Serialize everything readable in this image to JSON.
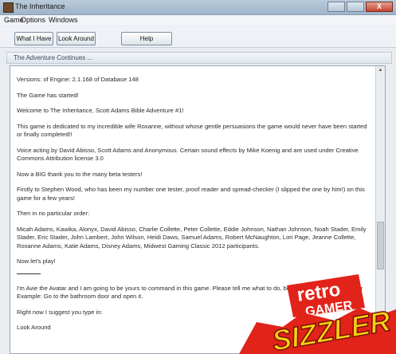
{
  "window": {
    "title": "The Inheritance",
    "close_label": "X"
  },
  "menu": [
    "Game",
    "Options",
    "Windows"
  ],
  "toolbar": {
    "what_have": "What I Have",
    "look_around": "Look Around",
    "help": "Help"
  },
  "panel": {
    "title": "The Adventure Continues ..."
  },
  "content": {
    "lines": [
      "Versions: of Engine: 2.1.168 of Database 148",
      "The Game has started!",
      "Welcome to The Inheritance, Scott Adams Bible Adventure #1!",
      "This game is dedicated to my incredible wife Roxanne, without whose gentle persuasions the game would never have been started or finally completed!!",
      "Voice acting by David Abisso, Scott Adams and Anonymous. Certain sound effects by Mike Koenig and are used under Creative Commons Attribution license 3.0",
      "Now a BIG thank you to the many beta testers!",
      "Firstly to Stephen Wood, who has been my number one tester, proof reader and spread-checker (I slipped the one by him!) on this game for a few years!",
      "Then in no particular order:",
      "Micah Adams, Kawika, Alonyx, David Abisso, Charlie Collette, Peter Collette, Eddie Johnson, Nathan Johnson, Noah Stader, Emily Stader, Eric Stader, John Lambert, John Wilson, Heidi Daws, Samuel Adams, Robert McNaughton, Lori Page, Jeanne Collette, Roxanne Adams, Katie Adams, Disney Adams, Midwest Gaming Classic 2012 participants.",
      "Now let's play!",
      "I'm Avie the Avatar and I am going to be yours to command in this game. Please tell me what to do, begin with an action verb. For Example: Go to the bathroom door and open it.",
      "Right now I suggest you type in:",
      "Look Around"
    ]
  },
  "logo": {
    "line1": "retro",
    "line2": "GAMER",
    "stamp": "SIZZLER"
  },
  "colors": {
    "logo_red": "#e2231a",
    "logo_yellow": "#f7d117",
    "titlebar": "#a9bcd0"
  }
}
